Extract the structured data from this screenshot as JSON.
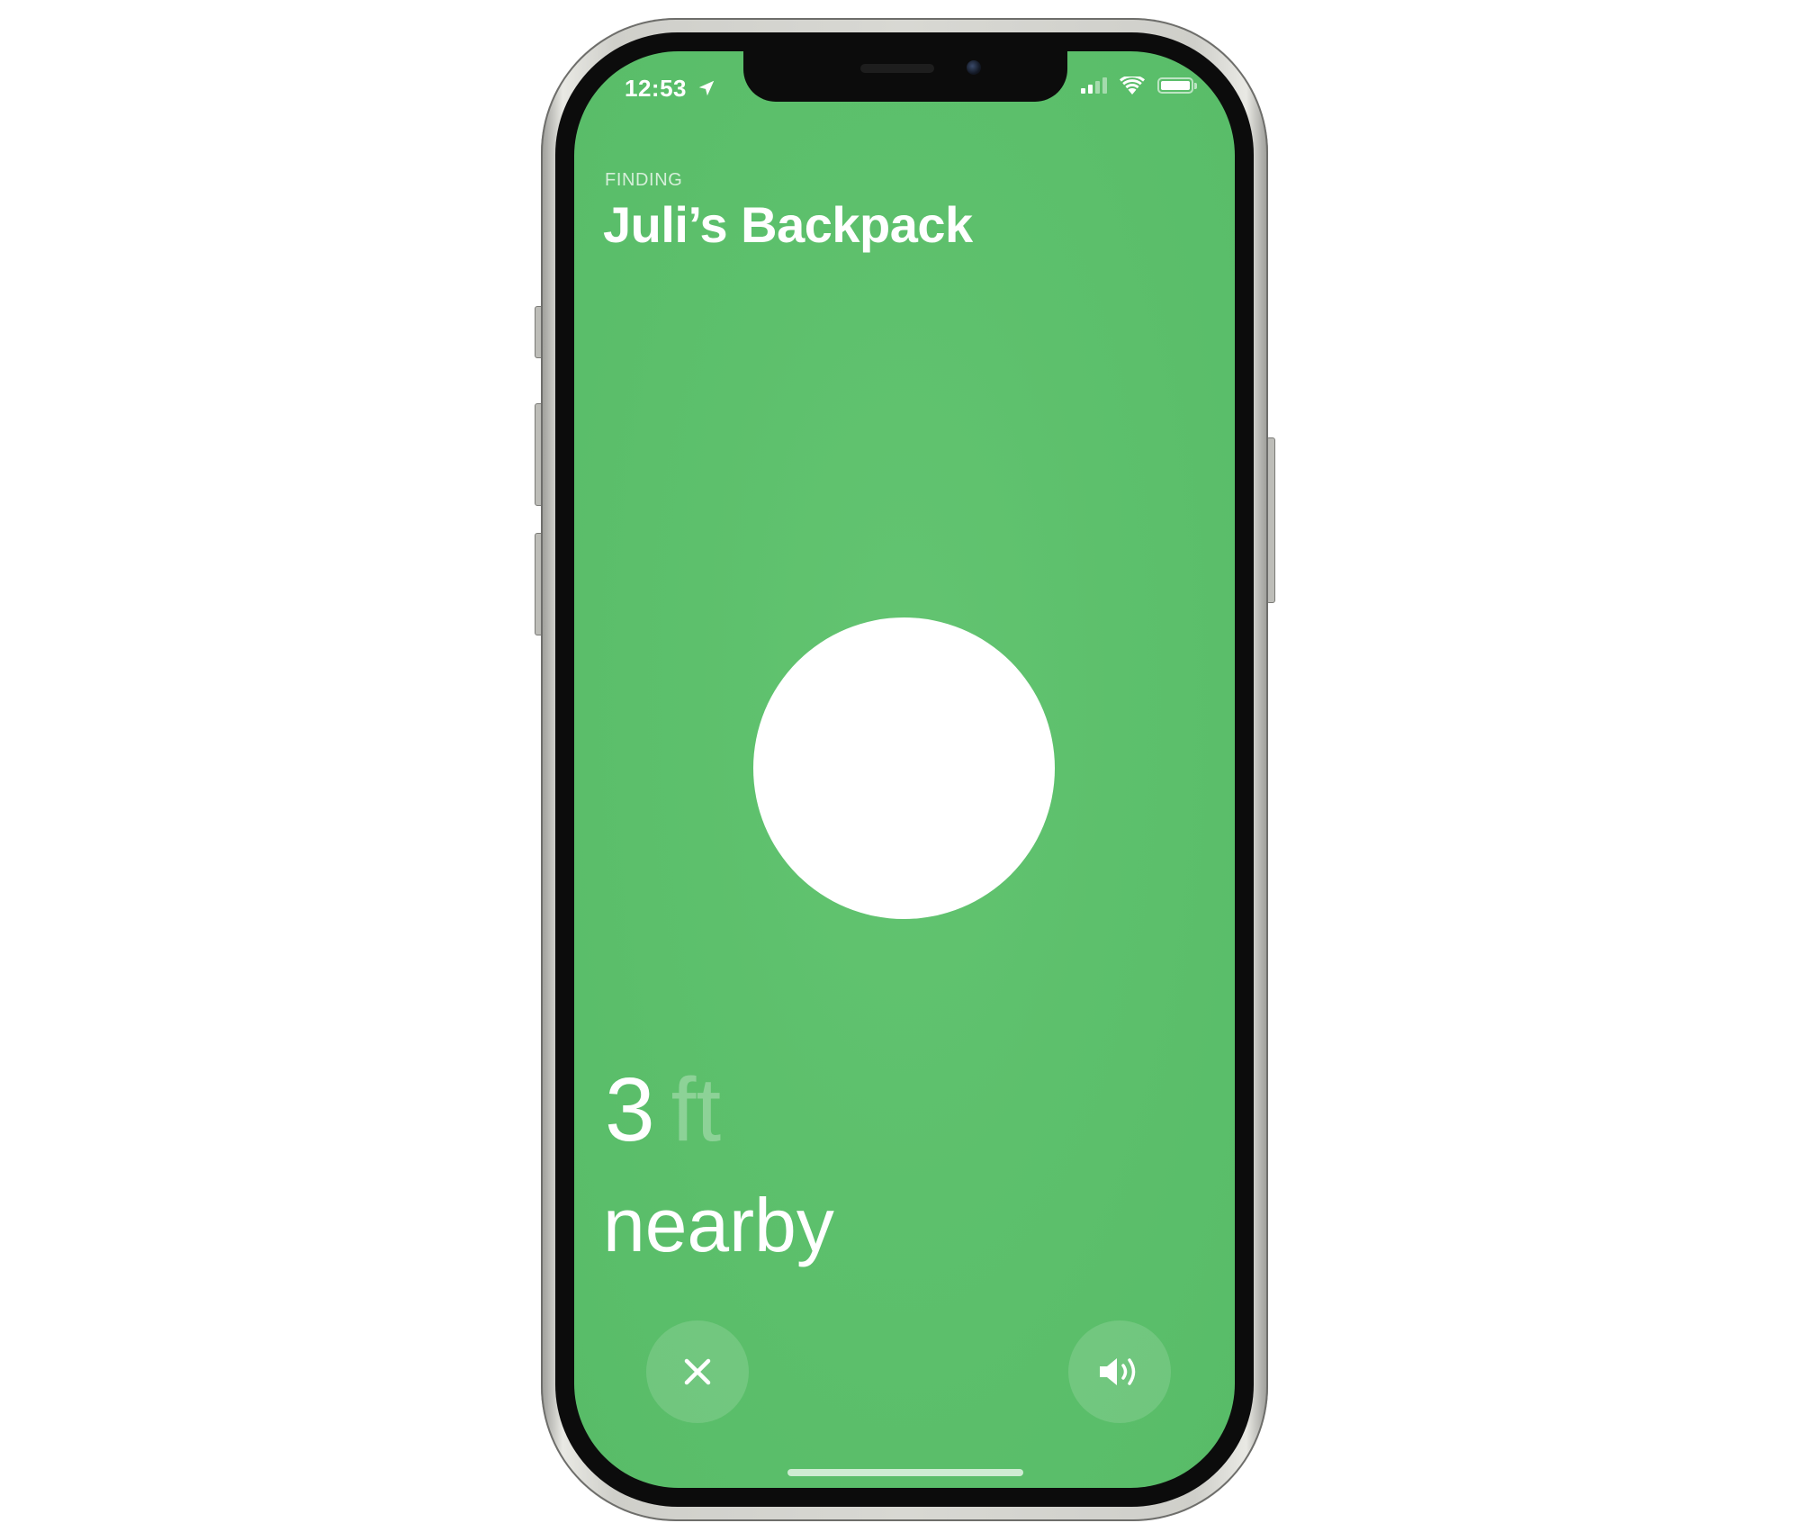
{
  "status_bar": {
    "time": "12:53",
    "location_icon": "location-arrow-icon",
    "signal_icon": "cellular-signal-icon",
    "wifi_icon": "wifi-icon",
    "battery_icon": "battery-icon"
  },
  "header": {
    "finding_label": "FINDING",
    "item_name": "Juli’s Backpack"
  },
  "distance": {
    "value": "3",
    "unit": "ft"
  },
  "direction_text": "nearby",
  "buttons": {
    "close_icon": "close-icon",
    "sound_icon": "speaker-sound-icon"
  },
  "colors": {
    "screen_green": "#5dc06c",
    "target_white": "#ffffff"
  }
}
